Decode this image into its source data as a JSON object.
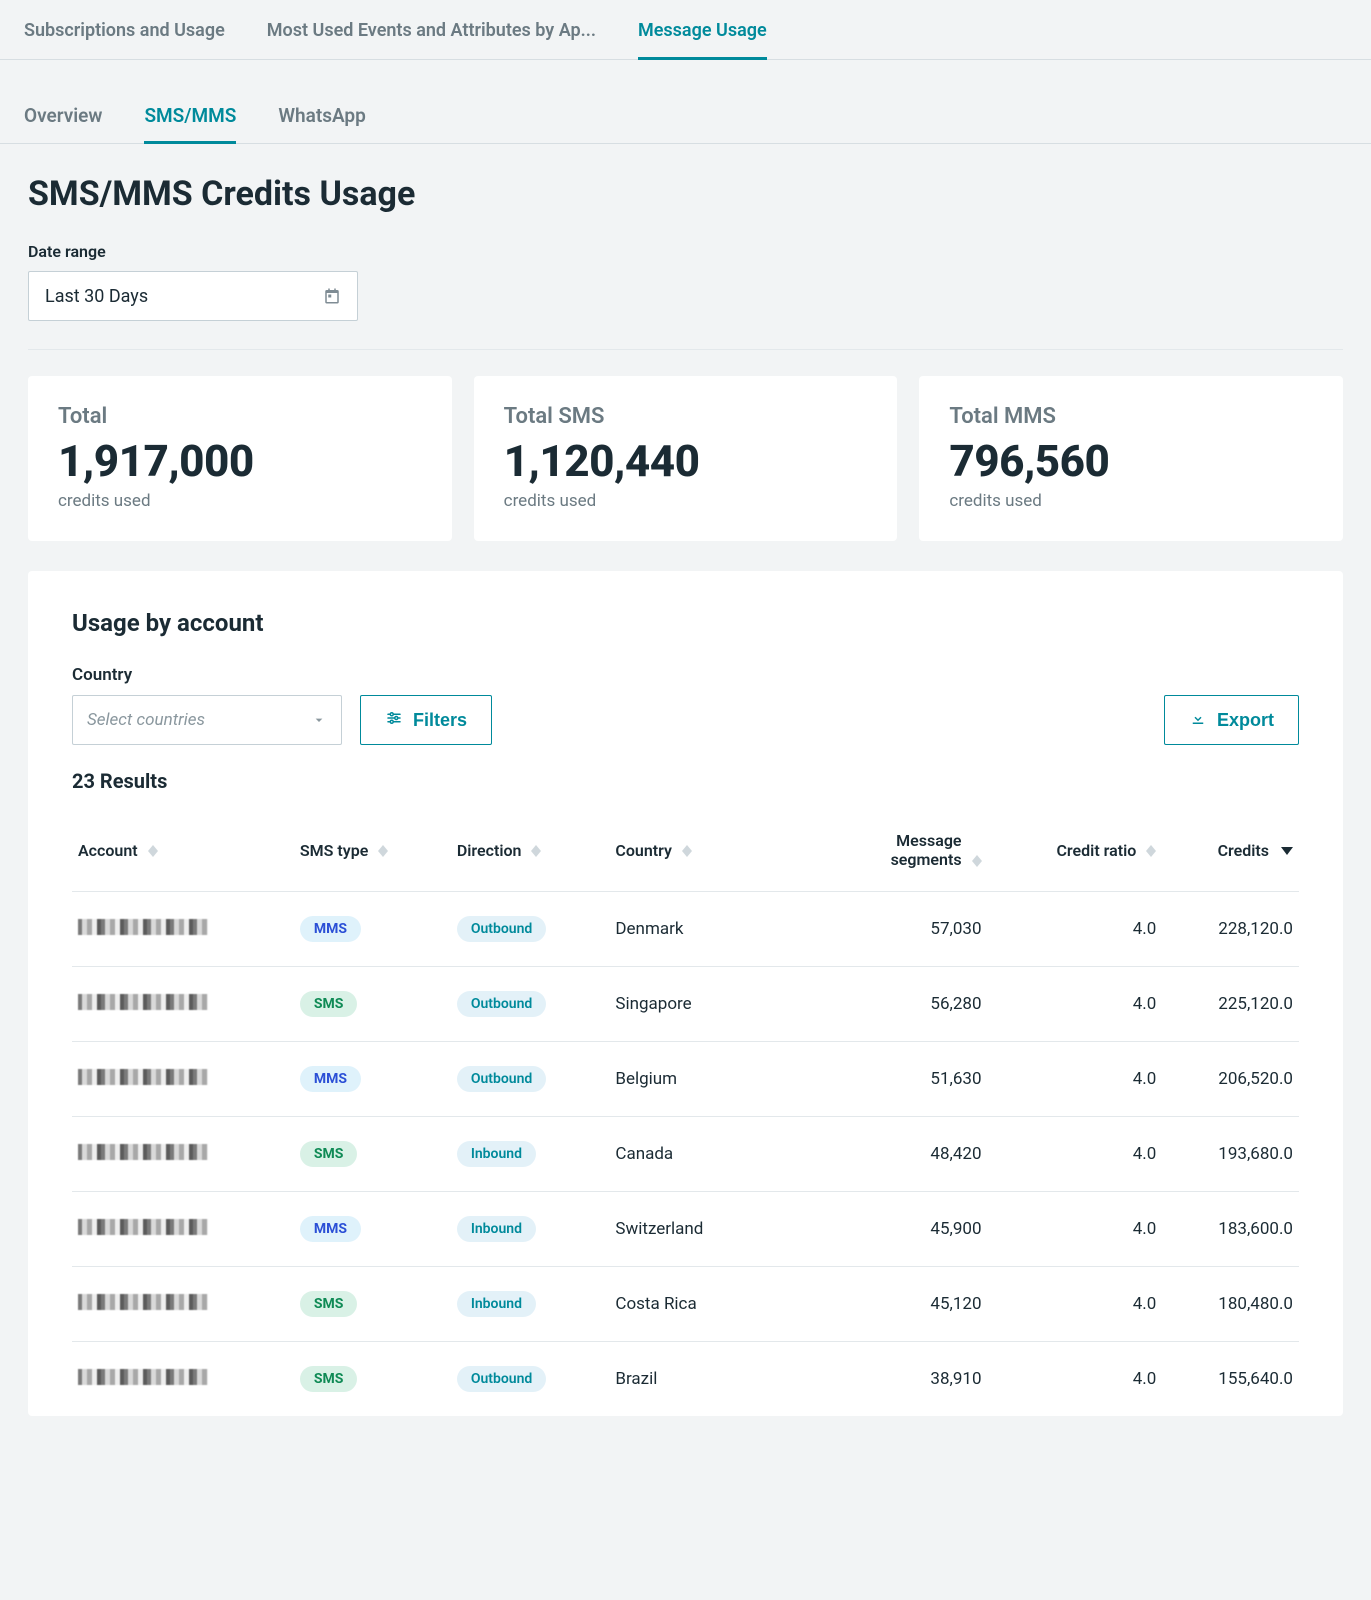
{
  "mainTabs": {
    "subscriptions": "Subscriptions and Usage",
    "mostUsed": "Most Used Events and Attributes by Ap...",
    "messageUsage": "Message Usage"
  },
  "subTabs": {
    "overview": "Overview",
    "smsmms": "SMS/MMS",
    "whatsapp": "WhatsApp"
  },
  "title": "SMS/MMS Credits Usage",
  "dateRange": {
    "label": "Date range",
    "value": "Last 30 Days"
  },
  "cards": {
    "total": {
      "label": "Total",
      "value": "1,917,000",
      "sub": "credits used"
    },
    "totalSms": {
      "label": "Total SMS",
      "value": "1,120,440",
      "sub": "credits used"
    },
    "totalMms": {
      "label": "Total MMS",
      "value": "796,560",
      "sub": "credits used"
    }
  },
  "usage": {
    "title": "Usage by account",
    "countryLabel": "Country",
    "countryPlaceholder": "Select countries",
    "filtersLabel": "Filters",
    "exportLabel": "Export",
    "resultsText": "23 Results"
  },
  "table": {
    "headers": {
      "account": "Account",
      "smsType": "SMS type",
      "direction": "Direction",
      "country": "Country",
      "segments": "Message segments",
      "creditRatio": "Credit ratio",
      "credits": "Credits"
    }
  },
  "rows": [
    {
      "type": "MMS",
      "dir": "Outbound",
      "country": "Denmark",
      "segments": "57,030",
      "ratio": "4.0",
      "credits": "228,120.0"
    },
    {
      "type": "SMS",
      "dir": "Outbound",
      "country": "Singapore",
      "segments": "56,280",
      "ratio": "4.0",
      "credits": "225,120.0"
    },
    {
      "type": "MMS",
      "dir": "Outbound",
      "country": "Belgium",
      "segments": "51,630",
      "ratio": "4.0",
      "credits": "206,520.0"
    },
    {
      "type": "SMS",
      "dir": "Inbound",
      "country": "Canada",
      "segments": "48,420",
      "ratio": "4.0",
      "credits": "193,680.0"
    },
    {
      "type": "MMS",
      "dir": "Inbound",
      "country": "Switzerland",
      "segments": "45,900",
      "ratio": "4.0",
      "credits": "183,600.0"
    },
    {
      "type": "SMS",
      "dir": "Inbound",
      "country": "Costa Rica",
      "segments": "45,120",
      "ratio": "4.0",
      "credits": "180,480.0"
    },
    {
      "type": "SMS",
      "dir": "Outbound",
      "country": "Brazil",
      "segments": "38,910",
      "ratio": "4.0",
      "credits": "155,640.0"
    }
  ]
}
